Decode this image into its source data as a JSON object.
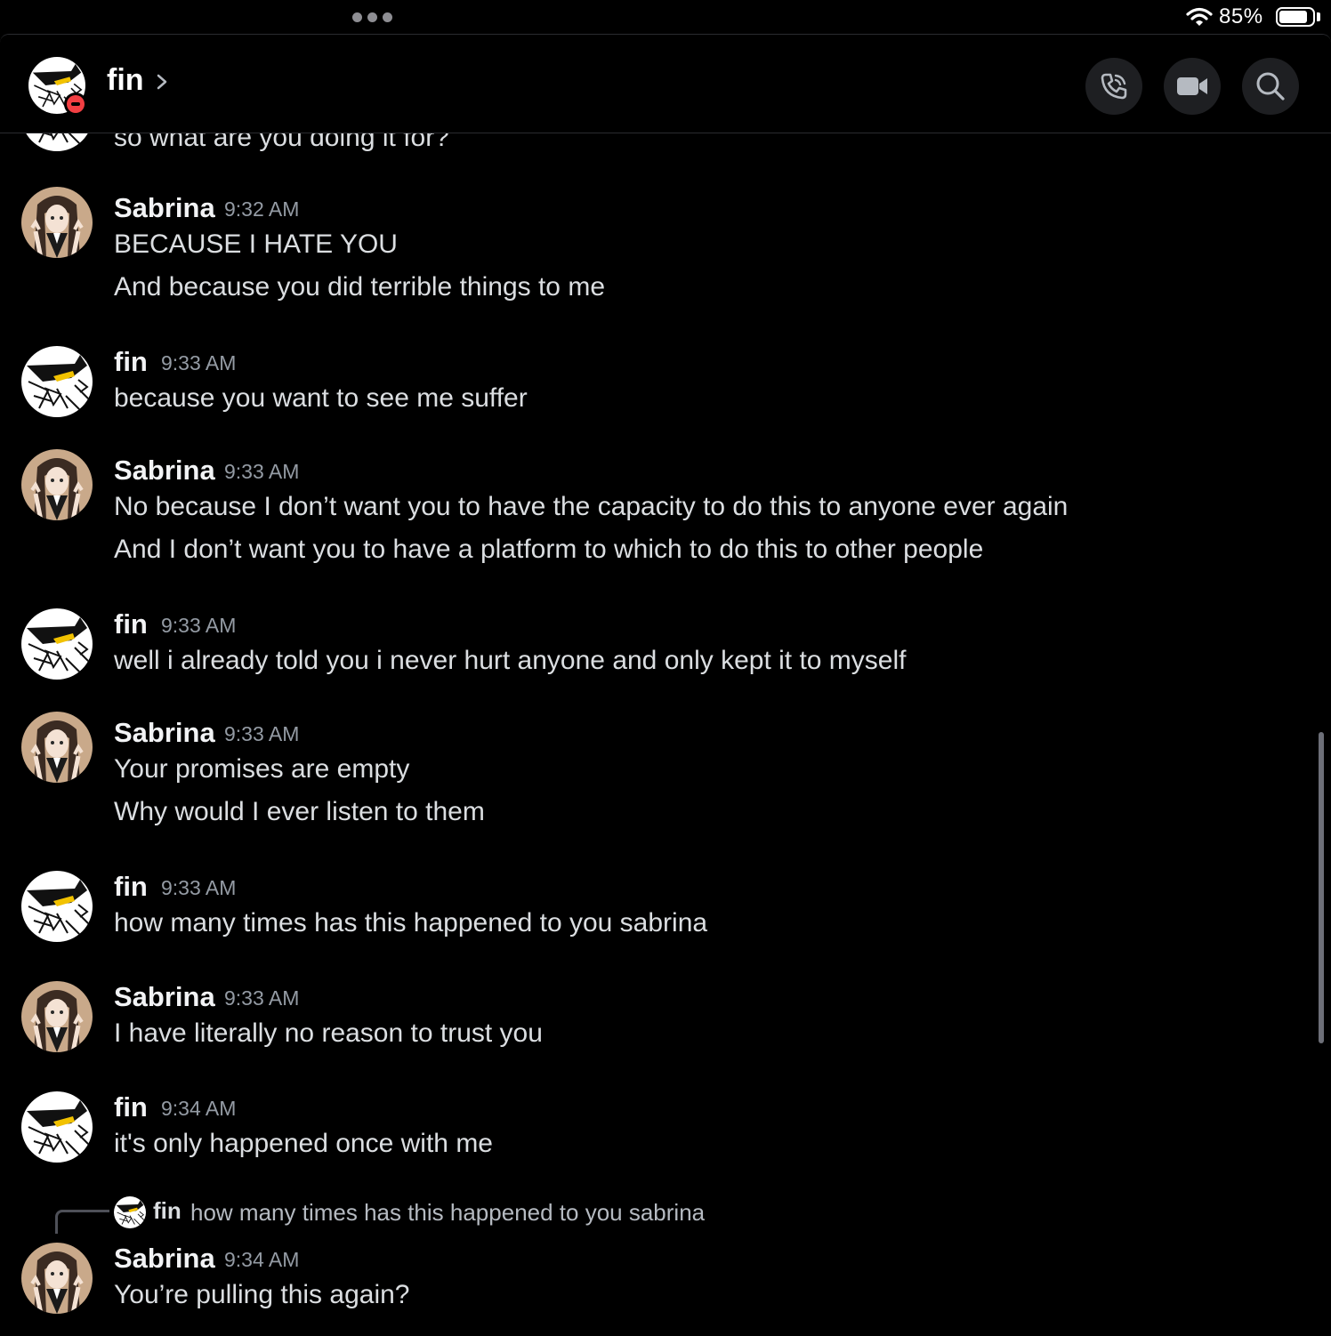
{
  "status_bar": {
    "battery": "85%"
  },
  "header": {
    "contact_name": "fin",
    "icons": [
      "phone-call-icon",
      "video-camera-icon",
      "search-icon"
    ]
  },
  "partial_top_message": "so what are you doing it for?",
  "messages": [
    {
      "author": "Sabrina",
      "time": "9:32 AM",
      "lines": [
        "BECAUSE I HATE YOU",
        "And because you did terrible things to me"
      ]
    },
    {
      "author": "fin",
      "time": "9:33 AM",
      "lines": [
        "because you want to see me suffer"
      ]
    },
    {
      "author": "Sabrina",
      "time": "9:33 AM",
      "lines": [
        "No because I don’t want you to have the capacity to do this to anyone ever again",
        "And I don’t want you to have a platform to which to do this to other people"
      ]
    },
    {
      "author": "fin",
      "time": "9:33 AM",
      "lines": [
        "well i already told you i never hurt anyone and only kept it to myself"
      ]
    },
    {
      "author": "Sabrina",
      "time": "9:33 AM",
      "lines": [
        "Your promises are empty",
        "Why would I ever listen to them"
      ]
    },
    {
      "author": "fin",
      "time": "9:33 AM",
      "lines": [
        "how many times has this happened to you sabrina"
      ]
    },
    {
      "author": "Sabrina",
      "time": "9:33 AM",
      "lines": [
        "I have literally no reason to trust you"
      ]
    },
    {
      "author": "fin",
      "time": "9:34 AM",
      "lines": [
        "it's only happened once with me"
      ]
    },
    {
      "author": "Sabrina",
      "time": "9:34 AM",
      "lines": [
        "You’re pulling this again?"
      ]
    }
  ],
  "reply_preview": {
    "author": "fin",
    "text": "how many times has this happened to you sabrina"
  },
  "colors": {
    "background": "#000000",
    "dnd_status": "#f23f43",
    "timestamp": "#949ba4"
  }
}
